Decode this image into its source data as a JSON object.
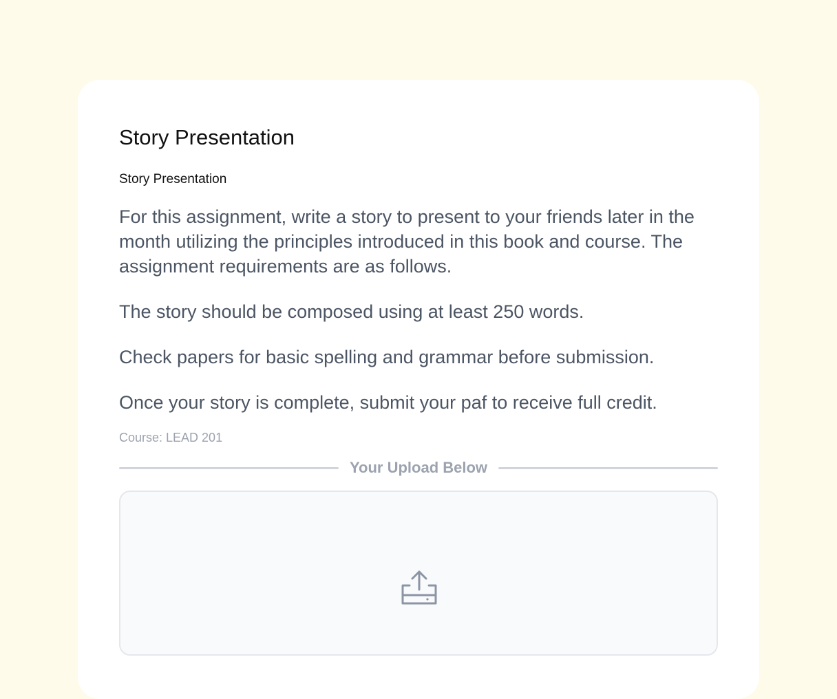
{
  "assignment": {
    "title": "Story Presentation",
    "subtitle": "Story Presentation",
    "paragraphs": [
      "For this assignment, write a story to present to your friends later in the month utilizing the principles introduced in this book and course. The assignment requirements are as follows.",
      "The story should be composed using at least 250 words.",
      "Check papers for basic spelling and grammar before submission.",
      "Once your story is complete, submit your paf to receive full credit."
    ],
    "course": "Course: LEAD 201"
  },
  "upload": {
    "section_label": "Your Upload Below",
    "icon": "upload-icon"
  },
  "colors": {
    "page_background": "#fefbea",
    "card_background": "#ffffff",
    "body_text": "#4b5563",
    "muted_text": "#9ca3af"
  }
}
